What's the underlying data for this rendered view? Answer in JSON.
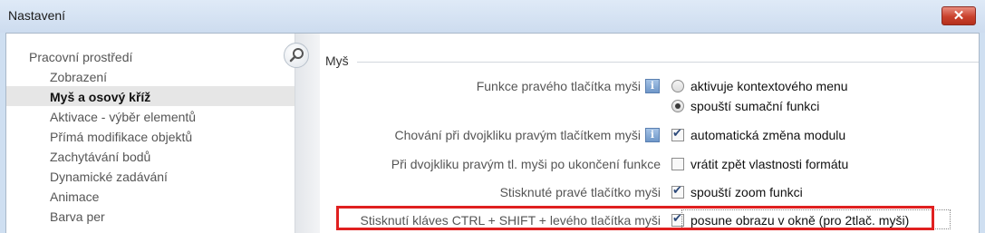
{
  "window": {
    "title": "Nastavení",
    "close_label": "✕"
  },
  "sidebar": {
    "items": [
      {
        "label": "Pracovní prostředí"
      },
      {
        "label": "Zobrazení"
      },
      {
        "label": "Myš a osový kříž"
      },
      {
        "label": "Aktivace - výběr elementů"
      },
      {
        "label": "Přímá modifikace objektů"
      },
      {
        "label": "Zachytávání bodů"
      },
      {
        "label": "Dynamické zadávání"
      },
      {
        "label": "Animace"
      },
      {
        "label": "Barva per"
      }
    ]
  },
  "section": {
    "title": "Myš"
  },
  "settings": [
    {
      "label": "Funkce pravého tlačítka myši",
      "has_info": true,
      "options": [
        {
          "type": "radio",
          "label": "aktivuje kontextového menu",
          "checked": false
        },
        {
          "type": "radio",
          "label": "spouští sumační funkci",
          "checked": true
        }
      ]
    },
    {
      "label": "Chování při dvojkliku pravým tlačítkem myši",
      "has_info": true,
      "options": [
        {
          "type": "checkbox",
          "label": "automatická změna modulu",
          "checked": true
        }
      ]
    },
    {
      "label": "Při dvojkliku pravým tl. myši po ukončení funkce",
      "has_info": false,
      "options": [
        {
          "type": "checkbox",
          "label": "vrátit zpět vlastnosti formátu",
          "checked": false
        }
      ]
    },
    {
      "label": "Stisknuté pravé tlačítko myši",
      "has_info": false,
      "options": [
        {
          "type": "checkbox",
          "label": "spouští zoom funkci",
          "checked": true
        }
      ]
    },
    {
      "label": "Stisknutí kláves CTRL + SHIFT + levého tlačítka myši",
      "has_info": false,
      "highlighted": true,
      "options": [
        {
          "type": "checkbox",
          "label": "posune obrazu v okně (pro 2tlač. myši)",
          "checked": true
        }
      ]
    }
  ],
  "icons": {
    "info": "info-icon",
    "search": "search-icon",
    "close": "close-icon"
  },
  "colors": {
    "highlight": "#e02020",
    "close_button": "#c9412d"
  }
}
